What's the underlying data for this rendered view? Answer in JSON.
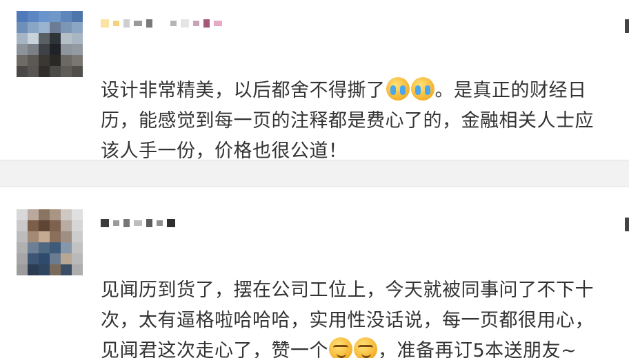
{
  "comments": [
    {
      "username_pixels": [
        "#fbe3a3",
        "#f4d27a",
        "#cfcfcf",
        "#9a9a9a",
        "#7a7a7a",
        "#b5b5b5",
        "#e5e5e5",
        "#c9a3b8",
        "#a35a7a",
        "#e7a9c5"
      ],
      "avatar_grid": [
        [
          "#4f79b8",
          "#5b86c3",
          "#6a95cc",
          "#6f97c8",
          "#5f86bb",
          "#4e76ab"
        ],
        [
          "#6e8fb7",
          "#8aa6c6",
          "#9bb3cf",
          "#6b7c94",
          "#7c96b8",
          "#8ca5c4"
        ],
        [
          "#a5b5c4",
          "#c8d2da",
          "#5a5f63",
          "#2f3438",
          "#b5bfc8",
          "#a8b6c3"
        ],
        [
          "#8d939a",
          "#7b8087",
          "#3e4246",
          "#1f2226",
          "#8e959c",
          "#939aa1"
        ],
        [
          "#6e6b66",
          "#5c5955",
          "#3a3835",
          "#2a2927",
          "#6c6964",
          "#7a7671"
        ],
        [
          "#4a4846",
          "#585552",
          "#2f2e2c",
          "#4c4a47",
          "#5f5c58",
          "#514f4c"
        ]
      ],
      "text_parts": [
        "设计非常精美，以后都舍不得撕了",
        "。是真正的财经日历，能感觉到每一页的注释都是费心了的，金融相关人士应该人手一份，价格也很公道！"
      ],
      "emoji_icon": "crying-face-icon"
    },
    {
      "username_pixels": [
        "#3a3a3a",
        "#9a9a9a",
        "#777777",
        "#bdbdbd",
        "#5c5c5c",
        "#8f8f8f",
        "#2e2e2e"
      ],
      "avatar_grid": [
        [
          "#d8d8d8",
          "#b9a89b",
          "#8c7462",
          "#a99584",
          "#cfc8c2",
          "#e0e0e0"
        ],
        [
          "#c9c9c9",
          "#7c5f4b",
          "#5f4535",
          "#7d6250",
          "#b8aca2",
          "#d6d6d6"
        ],
        [
          "#bcbcbc",
          "#a38a76",
          "#c5aa92",
          "#8a6f5b",
          "#9f8f82",
          "#cccccc"
        ],
        [
          "#b0b0b0",
          "#6d7f95",
          "#4e6884",
          "#3e5a79",
          "#8597ab",
          "#c2c2c2"
        ],
        [
          "#a6a6a6",
          "#3d5675",
          "#2e4a6c",
          "#6b7c90",
          "#b8a792",
          "#b9b9b9"
        ],
        [
          "#9c9c9c",
          "#2b3c52",
          "#304660",
          "#7a6a5c",
          "#3b4e66",
          "#adadad"
        ]
      ],
      "text_parts": [
        "见闻历到货了，摆在公司工位上，今天就被同事问了不下十次，太有逼格啦哈哈哈，实用性没话说，每一页都很用心，见闻君这次走心了，赞一个",
        "，准备再订5本送朋友~"
      ],
      "emoji_icon": "smirking-face-icon"
    }
  ]
}
